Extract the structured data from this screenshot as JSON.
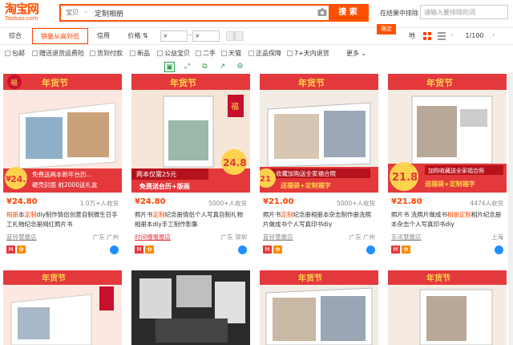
{
  "header": {
    "logo_cn": "淘宝网",
    "logo_en": "Taobao.com",
    "search_category": "宝贝",
    "search_query": "定制相册",
    "search_button": "搜 索",
    "within_label": "在结果中排除",
    "within_placeholder": "请输入要排除的词",
    "confirm": "确定"
  },
  "sort": {
    "items": [
      "综合",
      "销量从高到低",
      "信用",
      "价格"
    ],
    "price_min": "¥",
    "price_max": "¥",
    "region": "地",
    "page": "1/100"
  },
  "filters": [
    "包邮",
    "赠送退货运费险",
    "货到付款",
    "新品",
    "公益宝贝",
    "二手",
    "天猫",
    "正品保障",
    "7+天内退货",
    "更多"
  ],
  "colors": {
    "accent": "#ff5000",
    "price": "#ff4400",
    "tmall_red": "#e4393c"
  },
  "products": [
    {
      "banner": "年货节",
      "promo_price": "24.8",
      "promo_line1": "免费送两本新年台历...",
      "promo_line2": "硬壳封面 前2000送礼盒",
      "price": "¥24.80",
      "sales": "1.0万+人收货",
      "title_hl1": "相册",
      "title_mid1": "本",
      "title_hl2": "定制",
      "title_rest": "diy制作情侣创意自制微生日手工礼物纪念册网红照片书",
      "shop": "蓝铃慧屋店",
      "location": "广东 广州"
    },
    {
      "banner": "年货节",
      "promo_price": "24.8",
      "promo_line1": "两本仅需25元",
      "promo_line2": "免费送台历+版画",
      "price": "¥24.80",
      "sales": "5000+人收货",
      "title_hl1": "",
      "title_mid1": "照片书",
      "title_hl2": "定制",
      "title_rest": "纪念册情侣个人写真自制礼物相册本diy手工制作影集",
      "shop": "时间慢慢屋店",
      "location": "广东 深圳"
    },
    {
      "banner": "年货节",
      "promo_price": "21",
      "promo_line1": "收藏加购送全家福合照",
      "promo_line2": "送福袋+定制福字",
      "price": "¥21.00",
      "sales": "5000+人收货",
      "title_hl1": "",
      "title_mid1": "照片书",
      "title_hl2": "定制",
      "title_rest": "纪念册相册本杂志制作册洗照片做成书个人写真印书diy",
      "shop": "蓝铃慧屋店",
      "location": "广东 广州"
    },
    {
      "banner": "年货节",
      "promo_price": "21.8",
      "promo_line1": "加购收藏送全家福合照",
      "promo_line2": "送福袋+定制福字",
      "price": "¥21.80",
      "sales": "4474人收货",
      "title_hl1": "",
      "title_mid1": "照片书 洗照片做成书",
      "title_hl2": "相册定制",
      "title_rest": "相片纪念册本杂志个人写真印书diy",
      "shop": "东讯慧屋店",
      "location": "上海"
    }
  ],
  "row2_banner": [
    "年货节",
    "",
    "年货节",
    "年货节"
  ]
}
